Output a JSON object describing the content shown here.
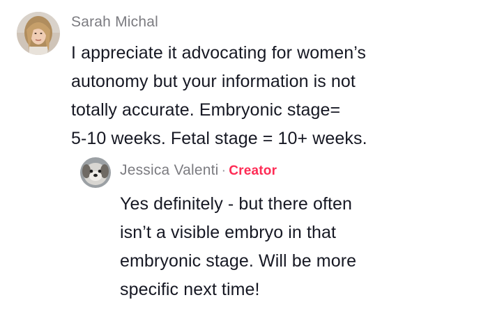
{
  "comment": {
    "username": "Sarah Michal",
    "text": "I appreciate it advocating for women’s\nautonomy but your information is not\ntotally accurate. Embryonic stage=\n5-10 weeks. Fetal stage = 10+ weeks.",
    "avatar_icon": "user-avatar-photo"
  },
  "reply": {
    "username": "Jessica Valenti",
    "separator": "·",
    "badge": "Creator",
    "badge_color": "#fe2c55",
    "text": "Yes definitely - but there often\nisn’t a visible embryo in that\nembryonic stage. Will be more\nspecific next time!",
    "avatar_icon": "dog-avatar-photo"
  }
}
